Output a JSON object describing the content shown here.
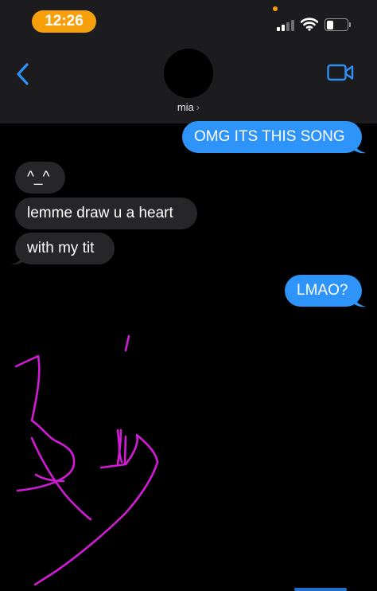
{
  "status_bar": {
    "time": "12:26",
    "accent_color": "#f7a00b",
    "icons": [
      "signal-icon",
      "wifi-icon",
      "battery-icon"
    ]
  },
  "header": {
    "contact_name": "mia",
    "chevron": "›",
    "icons": [
      "back-chevron-icon",
      "video-call-icon"
    ]
  },
  "messages": [
    {
      "direction": "outgoing",
      "text": "OMG ITS THIS SONG"
    },
    {
      "direction": "incoming",
      "text": "^_^"
    },
    {
      "direction": "incoming",
      "text": "lemme draw u a heart"
    },
    {
      "direction": "incoming",
      "text": "with my tit"
    },
    {
      "direction": "outgoing",
      "text": "LMAO?"
    }
  ],
  "drawing": {
    "color": "#d21bd6",
    "description_icon": "handwritten-sketch"
  },
  "colors": {
    "outgoing_bubble": "#2e94fa",
    "incoming_bubble": "#262628",
    "header_background": "#1c1c1e"
  }
}
